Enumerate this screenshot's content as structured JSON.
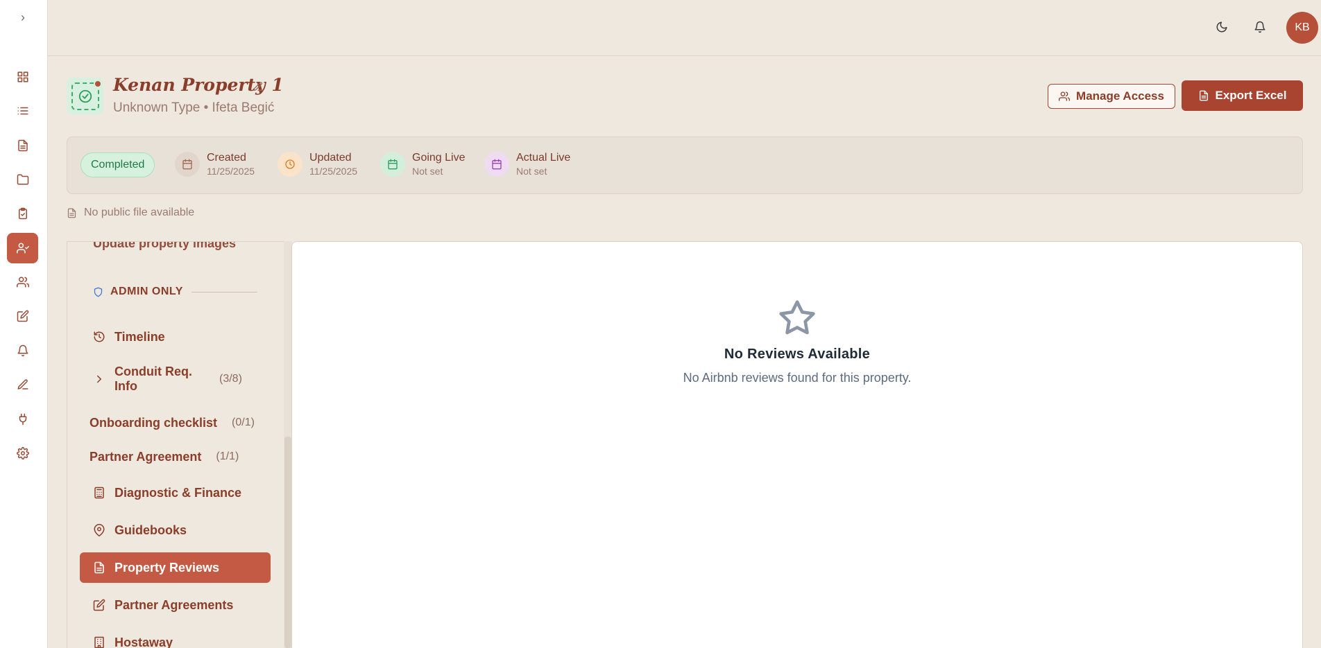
{
  "rail": {
    "toggle_glyph": "›",
    "items": [
      {
        "icon": "dashboard-icon"
      },
      {
        "icon": "list-icon"
      },
      {
        "icon": "document-icon"
      },
      {
        "icon": "folder-icon"
      },
      {
        "icon": "clipboard-check-icon"
      },
      {
        "icon": "user-check-icon",
        "active": true
      },
      {
        "icon": "users-icon"
      },
      {
        "icon": "edit-document-icon"
      },
      {
        "icon": "bell-icon"
      },
      {
        "icon": "pen-icon"
      },
      {
        "icon": "plug-icon"
      },
      {
        "icon": "gear-icon"
      }
    ]
  },
  "topbar": {
    "avatar_initials": "KB"
  },
  "property": {
    "title": "Kenan Property 1",
    "subtitle": "Unknown Type • Ifeta Begić"
  },
  "actions": {
    "manage_access": "Manage Access",
    "export_excel": "Export Excel"
  },
  "status": {
    "badge": "Completed",
    "created_label": "Created",
    "created_value": "11/25/2025",
    "updated_label": "Updated",
    "updated_value": "11/25/2025",
    "going_live_label": "Going Live",
    "going_live_value": "Not set",
    "actual_live_label": "Actual Live",
    "actual_live_value": "Not set"
  },
  "public_file": "No public file available",
  "sidenav": {
    "cut_item": "Update property images",
    "section_title": "ADMIN ONLY",
    "timeline": "Timeline",
    "conduit_label": "Conduit Req. Info",
    "conduit_count": "(3/8)",
    "onboarding_label": "Onboarding checklist",
    "onboarding_count": "(0/1)",
    "partner_agreement_label": "Partner Agreement",
    "partner_agreement_count": "(1/1)",
    "diagnostic": "Diagnostic & Finance",
    "guidebooks": "Guidebooks",
    "property_reviews": "Property Reviews",
    "partner_agreements": "Partner Agreements",
    "hostaway": "Hostaway"
  },
  "content": {
    "empty_title": "No Reviews Available",
    "empty_subtitle": "No Airbnb reviews found for this property."
  },
  "colors": {
    "accent": "#c45a43",
    "brand_dark": "#a84430",
    "completed_green": "#1e7a45"
  }
}
